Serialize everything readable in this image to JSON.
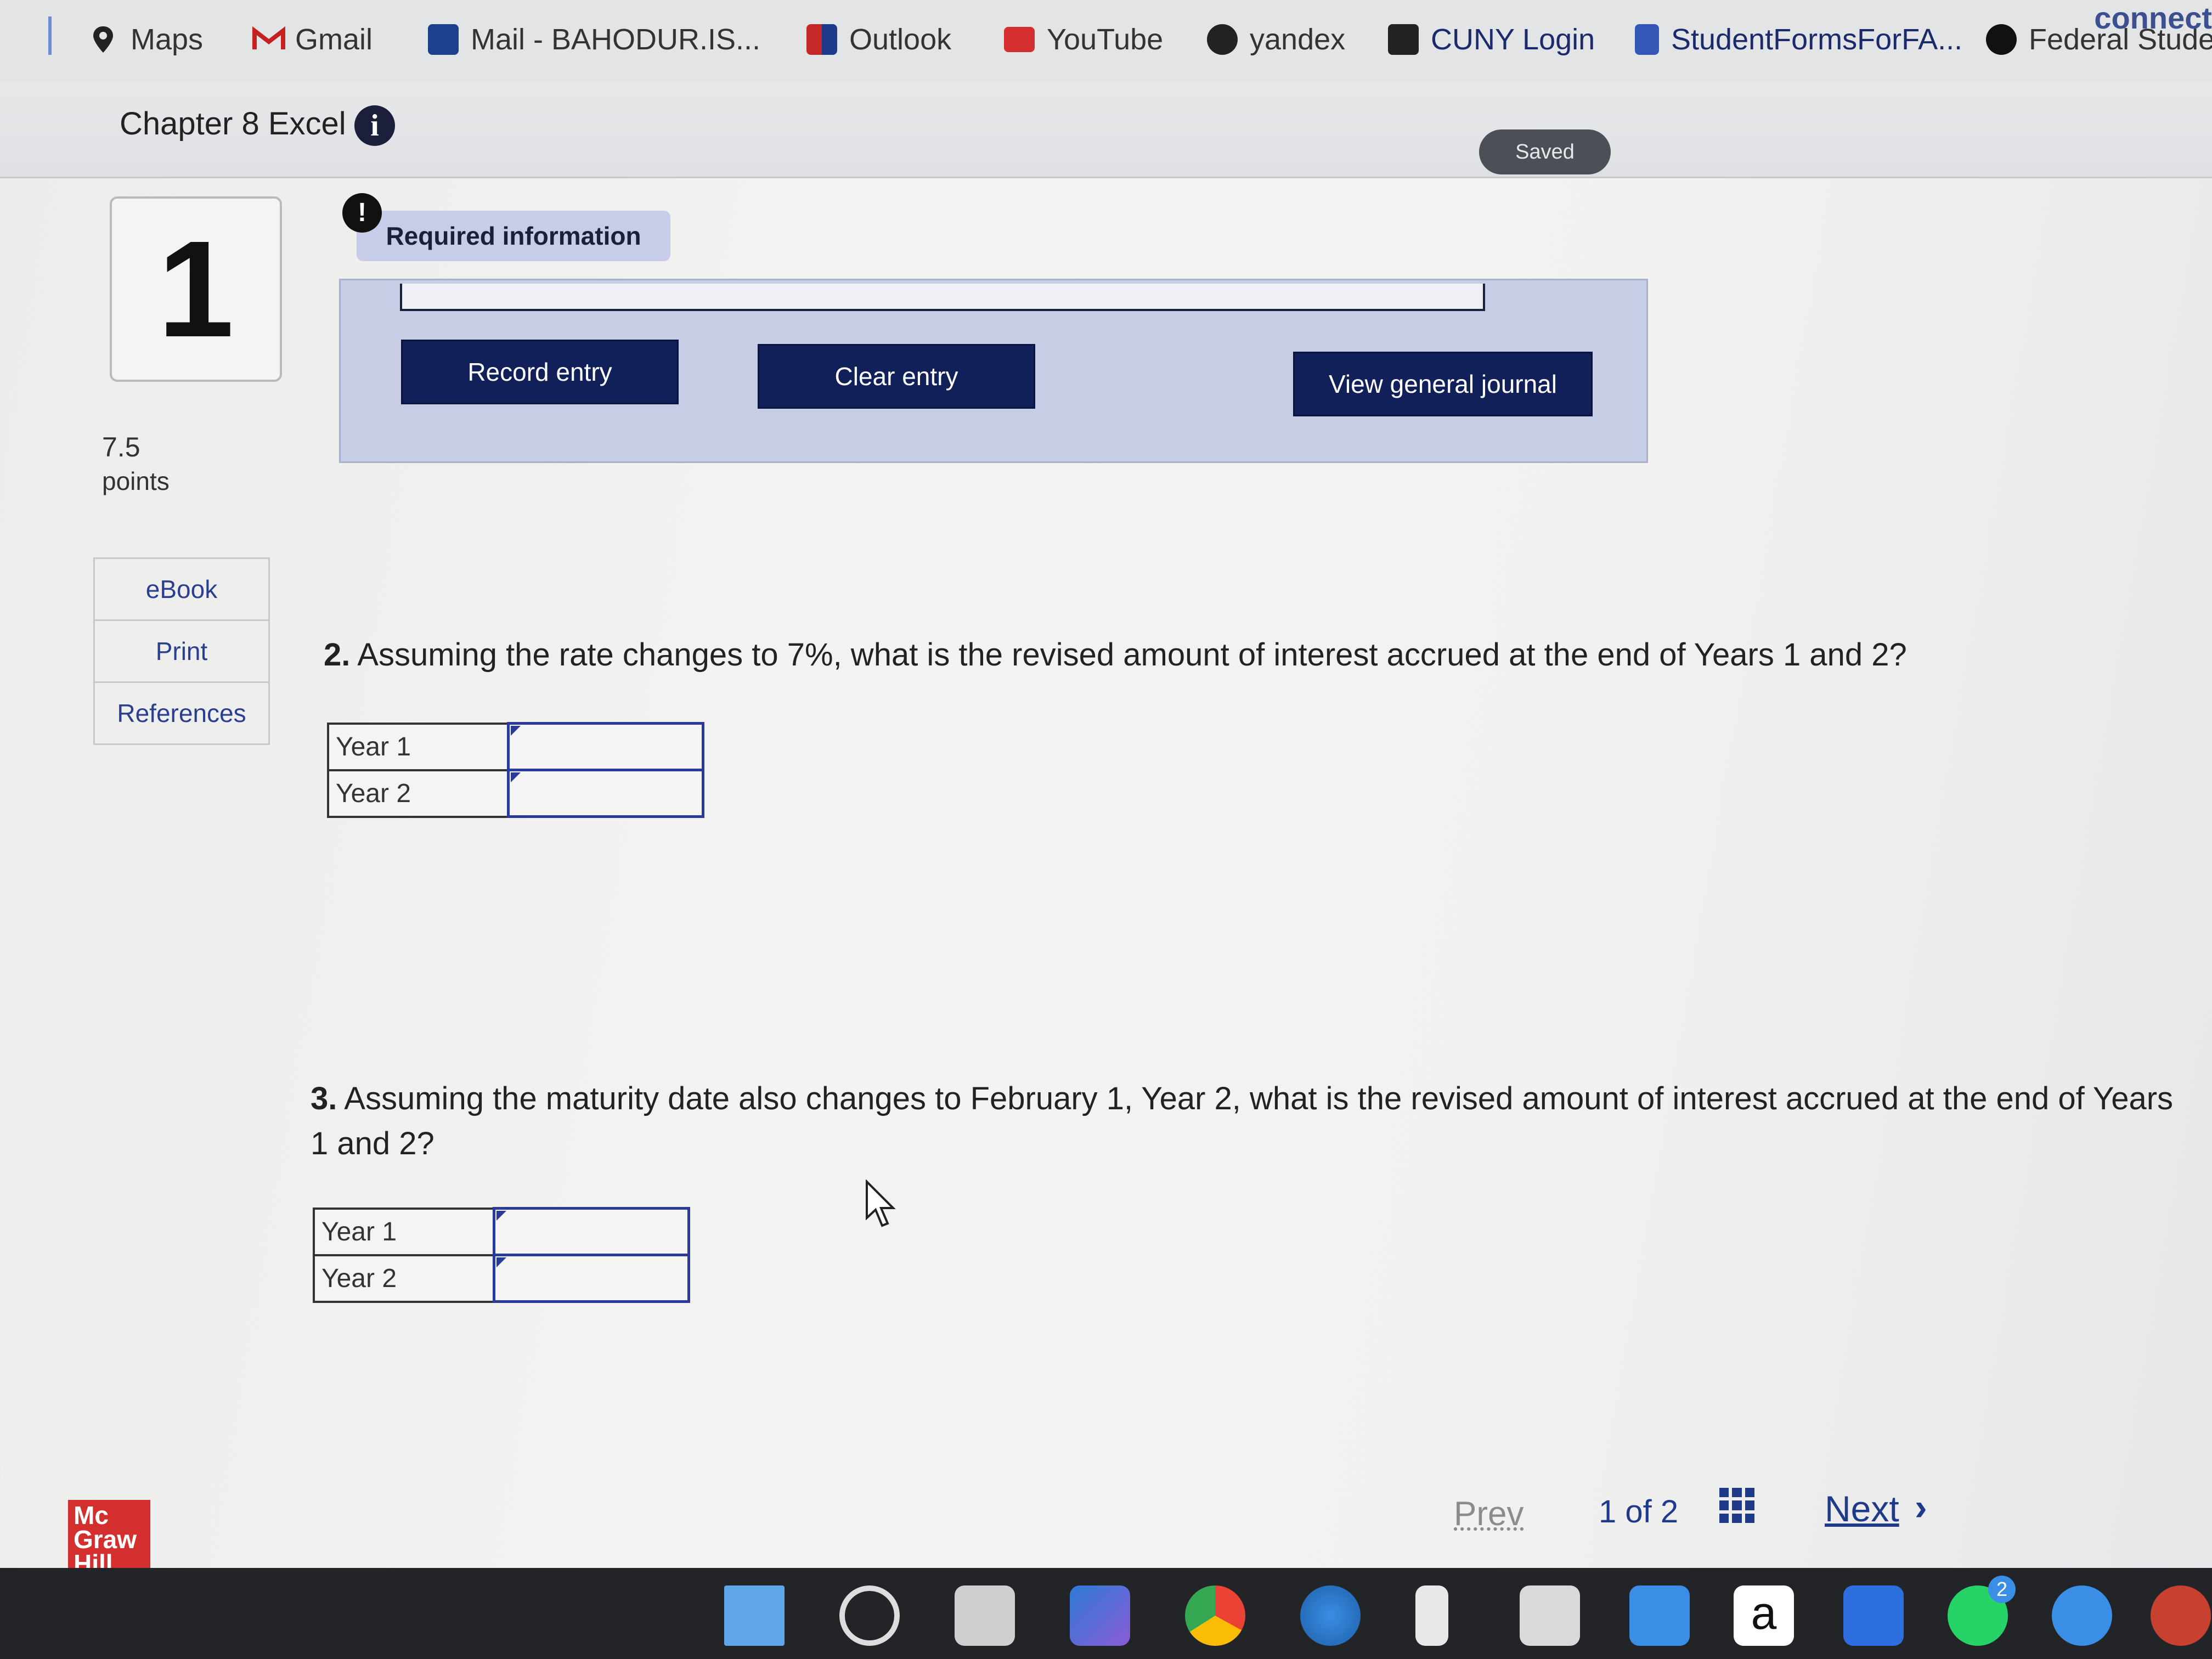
{
  "bookmarks": [
    {
      "label": "Maps",
      "icon": "map-pin-icon"
    },
    {
      "label": "Gmail",
      "icon": "gmail-icon"
    },
    {
      "label": "Mail - BAHODUR.IS...",
      "icon": "outlook-mail-icon"
    },
    {
      "label": "Outlook",
      "icon": "outlook-icon"
    },
    {
      "label": "YouTube",
      "icon": "youtube-icon"
    },
    {
      "label": "yandex",
      "icon": "yandex-icon"
    },
    {
      "label": "CUNY Login",
      "icon": "cuny-icon"
    },
    {
      "label": "StudentFormsForFA...",
      "icon": "document-icon"
    },
    {
      "label": "Federal Studen",
      "icon": "federal-student-aid-icon"
    }
  ],
  "brand_edge": "connect",
  "assignment": {
    "title": "Chapter 8 Excel",
    "saved_label": "Saved"
  },
  "question": {
    "number": "1",
    "points_value": "7.5",
    "points_label": "points"
  },
  "side_links": [
    "eBook",
    "Print",
    "References"
  ],
  "required_info": {
    "label": "Required information"
  },
  "journal_buttons": {
    "record": "Record entry",
    "clear": "Clear entry",
    "view": "View general journal"
  },
  "q2": {
    "number": "2.",
    "text": "Assuming the rate changes to 7%, what is the revised amount of interest accrued at the end of Years 1 and 2?",
    "rows": [
      "Year 1",
      "Year 2"
    ]
  },
  "q3": {
    "number": "3.",
    "text": "Assuming the maturity date also changes to February 1, Year 2, what is the revised amount of interest accrued at the end of Years 1 and 2?",
    "rows": [
      "Year 1",
      "Year 2"
    ]
  },
  "footer": {
    "logo": [
      "Mc",
      "Graw",
      "Hill"
    ],
    "prev": "Prev",
    "page_current": "1",
    "page_of": "of",
    "page_total": "2",
    "next": "Next"
  },
  "taskbar": {
    "whatsapp_badge": "2"
  },
  "colors": {
    "primary_button": "#12205a",
    "link": "#1f3a8a",
    "panel": "#c8cde6",
    "logo": "#d32f2f"
  }
}
